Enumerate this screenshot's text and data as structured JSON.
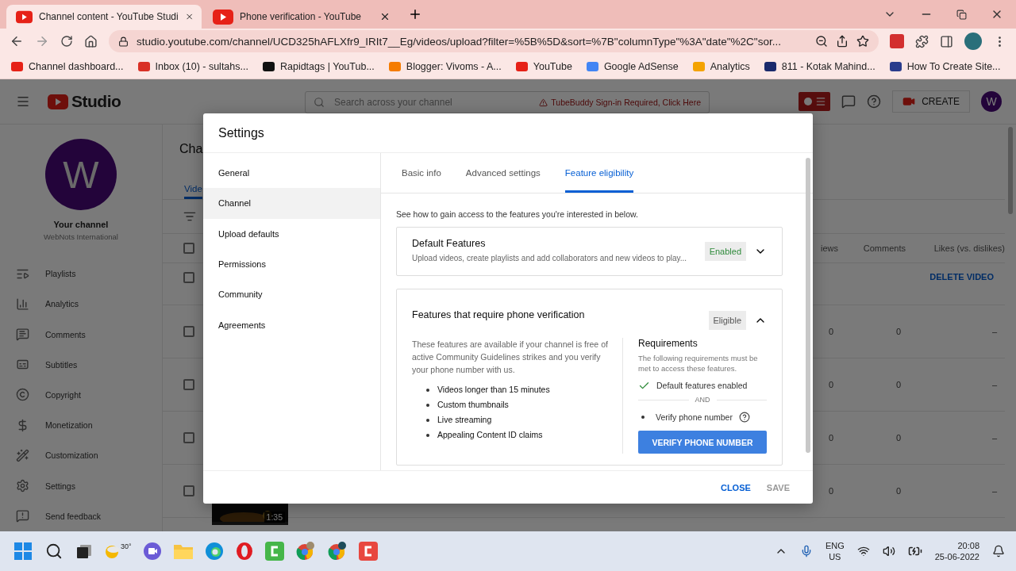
{
  "browser": {
    "tabs": [
      {
        "title": "Channel content - YouTube Studi",
        "selected": true
      },
      {
        "title": "Phone verification - YouTube",
        "selected": false
      }
    ],
    "url": "studio.youtube.com/channel/UCD325hAFLXfr9_IRIt7__Eg/videos/upload?filter=%5B%5D&sort=%7B\"columnType\"%3A\"date\"%2C\"sor...",
    "bookmarks": [
      "Channel dashboard...",
      "Inbox (10) - sultahs...",
      "Rapidtags | YouTub...",
      "Blogger: Vivoms - A...",
      "YouTube",
      "Google AdSense",
      "Analytics",
      "811 - Kotak Mahind...",
      "How To Create Site..."
    ]
  },
  "studio": {
    "header": {
      "logo": "Studio",
      "search_placeholder": "Search across your channel",
      "notice": "TubeBuddy Sign-in Required, Click Here",
      "create": "CREATE",
      "avatar": "W"
    },
    "sidebar": {
      "avatar": "W",
      "title": "Your channel",
      "subtitle": "WebNots International",
      "items": [
        "Playlists",
        "Analytics",
        "Comments",
        "Subtitles",
        "Copyright",
        "Monetization",
        "Customization",
        "Settings",
        "Send feedback"
      ]
    },
    "content": {
      "all_checked": false,
      "title": "Cha",
      "tab": "Vide",
      "columns": [
        "iews",
        "Comments",
        "Likes (vs. dislikes)"
      ],
      "rows": [
        {
          "kind": "action",
          "checked": false,
          "action": "DELETE VIDEO"
        },
        {
          "kind": "stats",
          "checked": false,
          "views": "0",
          "comments": "0",
          "likes": "–"
        },
        {
          "kind": "stats",
          "checked": false,
          "views": "0",
          "comments": "0",
          "likes": "–"
        },
        {
          "kind": "stats",
          "checked": false,
          "views": "0",
          "comments": "0",
          "likes": "–"
        },
        {
          "kind": "stats",
          "checked": false,
          "views": "0",
          "comments": "0",
          "likes": "–",
          "duration": "1:35"
        }
      ]
    }
  },
  "dialog": {
    "title": "Settings",
    "nav": [
      {
        "label": "General",
        "selected": false
      },
      {
        "label": "Channel",
        "selected": true
      },
      {
        "label": "Upload defaults",
        "selected": false
      },
      {
        "label": "Permissions",
        "selected": false
      },
      {
        "label": "Community",
        "selected": false
      },
      {
        "label": "Agreements",
        "selected": false
      }
    ],
    "tabs": [
      {
        "label": "Basic info",
        "selected": false
      },
      {
        "label": "Advanced settings",
        "selected": false
      },
      {
        "label": "Feature eligibility",
        "selected": true
      }
    ],
    "intro": "See how to gain access to the features you're interested in below.",
    "cards": [
      {
        "title": "Default Features",
        "subtitle": "Upload videos, create playlists and add collaborators and new videos to play...",
        "status": "Enabled",
        "color": "#2f8a3b",
        "expanded": false
      },
      {
        "title": "Features that require phone verification",
        "status": "Eligible",
        "color": "#555555",
        "expanded": true,
        "description": "These features are available if your channel is free of active Community Guidelines strikes and you verify your phone number with us.",
        "features": [
          "Videos longer than 15 minutes",
          "Custom thumbnails",
          "Live streaming",
          "Appealing Content ID claims"
        ],
        "requirements": {
          "title": "Requirements",
          "description": "The following requirements must be met to access these features.",
          "items": [
            {
              "label": "Default features enabled",
              "met": true,
              "help": false
            },
            {
              "label": "Verify phone number",
              "met": false,
              "help": true
            }
          ],
          "separator": "AND",
          "action": "VERIFY PHONE NUMBER"
        }
      }
    ],
    "buttons": [
      {
        "label": "CLOSE",
        "disabled": false
      },
      {
        "label": "SAVE",
        "disabled": true
      }
    ]
  },
  "taskbar": {
    "weather": "30°",
    "language": "ENG",
    "region": "US",
    "time": "20:08",
    "date": "25-06-2022"
  }
}
